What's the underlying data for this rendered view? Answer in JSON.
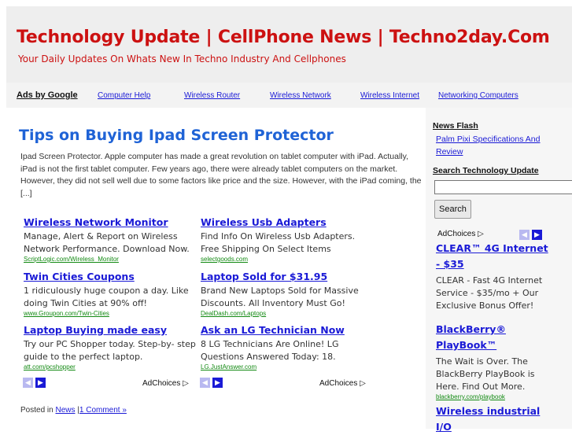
{
  "header": {
    "site_title": "Technology Update | CellPhone News | Techno2day.Com",
    "tagline": "Your Daily Updates On Whats New In Techno Industry And Cellphones"
  },
  "adbar": {
    "label": "Ads by Google",
    "links": [
      "Computer Help",
      "Wireless Router",
      "Wireless Network",
      "Wireless Internet",
      "Networking Computers"
    ]
  },
  "post": {
    "title": "Tips on Buying Ipad Screen Protector",
    "excerpt": "Ipad Screen Protector. Apple computer has made a great revolution on tablet computer with iPad. Actually, iPad is not the first tablet computer. Few years ago, there were already tablet computers on the market. However, they did not sell well due to some factors like price and the size. However, with the iPad coming, the [...]",
    "posted_in": "Posted in",
    "category": "News",
    "separator": "|",
    "comments": "1 Comment »"
  },
  "ads_left": [
    {
      "title": "Wireless Network Monitor",
      "text": "Manage, Alert & Report on Wireless Network Performance. Download Now.",
      "url": "ScriptLogic.com/Wireless_Monitor"
    },
    {
      "title": "Twin Cities Coupons",
      "text": "1 ridiculously huge coupon a day. Like doing Twin Cities at 90% off!",
      "url": "www.Groupon.com/Twin-Cities"
    },
    {
      "title": "Laptop Buying made easy",
      "text": "Try our PC Shopper today. Step-by- step guide to the perfect laptop.",
      "url": "att.com/pcshopper"
    }
  ],
  "ads_right": [
    {
      "title": "Wireless Usb Adapters",
      "text": "Find Info On Wireless Usb Adapters. Free Shipping On Select Items",
      "url": "selectgoods.com"
    },
    {
      "title": "Laptop Sold for $31.95",
      "text": "Brand New Laptops Sold for Massive Discounts. All Inventory Must Go!",
      "url": "DealDash.com/Laptops"
    },
    {
      "title": "Ask an LG Technician Now",
      "text": "8 LG Technicians Are Online! LG Questions Answered Today: 18.",
      "url": "LG.JustAnswer.com"
    }
  ],
  "adchoices": "AdChoices ▷",
  "nav": {
    "prev": "◀",
    "next": "▶"
  },
  "sidebar": {
    "news_flash_heading": "News Flash",
    "news_flash_link": "Palm Pixi Specifications And Review",
    "search_heading": "Search Technology Update",
    "search_value": "",
    "search_button": "Search",
    "adchoices": "AdChoices ▷",
    "ads": [
      {
        "title": "CLEAR™ 4G Internet - $35",
        "text": "CLEAR - Fast 4G Internet Service - $35/mo + Our Exclusive Bonus Offer!",
        "url": ""
      },
      {
        "title": "BlackBerry® PlayBook™",
        "text": "The Wait is Over. The BlackBerry PlayBook is Here. Find Out More.",
        "url": "blackberry.com/playbook"
      },
      {
        "title": "Wireless industrial I/O",
        "text": "",
        "url": ""
      }
    ]
  },
  "colors": {
    "title_red": "#cc1111",
    "link_blue": "#1a1ad6",
    "post_title_blue": "#1f63d6",
    "url_green": "#138a13"
  }
}
